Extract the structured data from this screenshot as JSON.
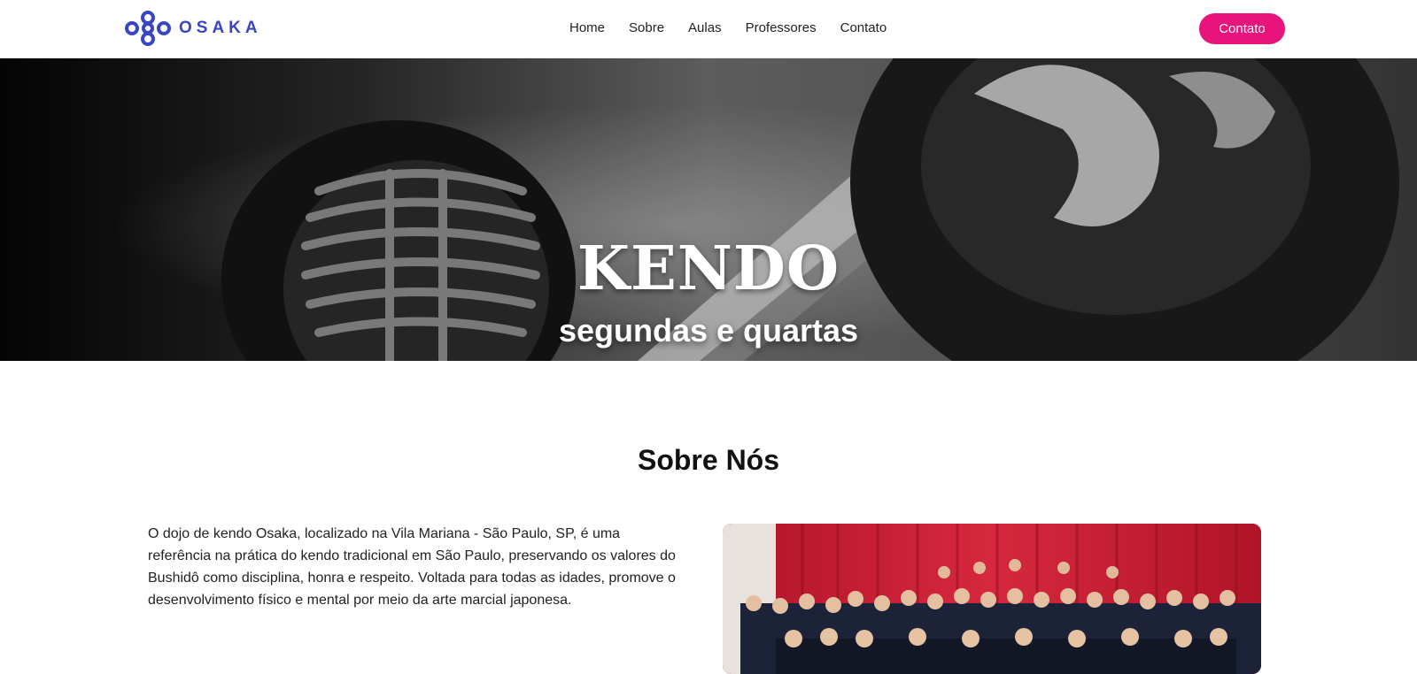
{
  "header": {
    "brand": "OSAKA",
    "nav": [
      {
        "label": "Home"
      },
      {
        "label": "Sobre"
      },
      {
        "label": "Aulas"
      },
      {
        "label": "Professores"
      },
      {
        "label": "Contato"
      }
    ],
    "cta_label": "Contato",
    "colors": {
      "brand": "#3a45c4",
      "cta": "#e8137b"
    }
  },
  "hero": {
    "title": "KENDO",
    "subtitle": "segundas e quartas",
    "image": "kendo-mask-hero-photo"
  },
  "about": {
    "title": "Sobre Nós",
    "text": "O dojo de kendo Osaka, localizado na Vila Mariana - São Paulo, SP, é uma referência na prática do kendo tradicional em São Paulo, preservando os valores do Bushidô como disciplina, honra e respeito. Voltada para todas as idades, promove o desenvolvimento físico e mental por meio da arte marcial japonesa.",
    "image": "group-photo-kendo-students"
  }
}
